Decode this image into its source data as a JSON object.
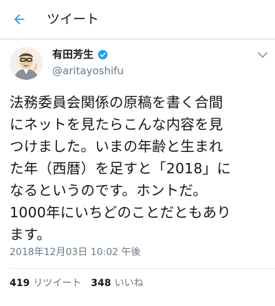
{
  "header": {
    "back_icon": "arrow-left-icon",
    "title": "ツイート"
  },
  "author": {
    "name": "有田芳生",
    "handle": "@aritayoshifu",
    "verified_icon": "verified-badge-icon",
    "menu_icon": "chevron-down-icon"
  },
  "tweet": {
    "lines": [
      "法務委員会関係の原稿を書く合間",
      "にネットを見たらこんな内容を見",
      "つけました。いまの年齢と生まれ",
      "た年（西暦）を足すと「2018」に",
      "なるというのです。ホントだ。",
      "1000年にいちどのことだともあり",
      "ます。"
    ],
    "timestamp": "2018年12月03日 10:02 午後"
  },
  "stats": {
    "retweets_count": "419",
    "retweets_label": "リツイート",
    "likes_count": "348",
    "likes_label": "いいね"
  },
  "colors": {
    "accent": "#1da1f2",
    "text": "#14171a",
    "secondary": "#657786",
    "divider": "#e6ecf0"
  }
}
